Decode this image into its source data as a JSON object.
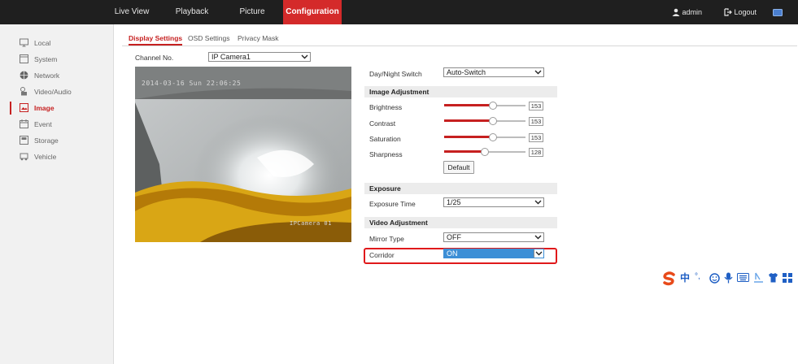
{
  "nav": {
    "tabs": [
      {
        "label": "Live View"
      },
      {
        "label": "Playback"
      },
      {
        "label": "Picture"
      },
      {
        "label": "Configuration"
      }
    ],
    "user": "admin",
    "logout": "Logout"
  },
  "sidebar": {
    "items": [
      {
        "label": "Local",
        "icon": "monitor-icon"
      },
      {
        "label": "System",
        "icon": "system-icon"
      },
      {
        "label": "Network",
        "icon": "network-icon"
      },
      {
        "label": "Video/Audio",
        "icon": "video-audio-icon"
      },
      {
        "label": "Image",
        "icon": "image-icon"
      },
      {
        "label": "Event",
        "icon": "event-icon"
      },
      {
        "label": "Storage",
        "icon": "storage-icon"
      },
      {
        "label": "Vehicle",
        "icon": "vehicle-icon"
      }
    ]
  },
  "subtabs": [
    "Display Settings",
    "OSD Settings",
    "Privacy Mask"
  ],
  "channel": {
    "label": "Channel No.",
    "value": "IP Camera1"
  },
  "video": {
    "osd_time": "2014-03-16 Sun 22:06:25",
    "osd_name": "IPCamera 01"
  },
  "settings": {
    "day_night": {
      "label": "Day/Night Switch",
      "value": "Auto-Switch"
    },
    "image_adjustment": {
      "header": "Image Adjustment",
      "brightness": {
        "label": "Brightness",
        "value": "153",
        "level": 0.6
      },
      "contrast": {
        "label": "Contrast",
        "value": "153",
        "level": 0.6
      },
      "saturation": {
        "label": "Saturation",
        "value": "153",
        "level": 0.6
      },
      "sharpness": {
        "label": "Sharpness",
        "value": "128",
        "level": 0.5
      },
      "default_button": "Default"
    },
    "exposure": {
      "header": "Exposure",
      "exposure_time": {
        "label": "Exposure Time",
        "value": "1/25"
      }
    },
    "video_adjustment": {
      "header": "Video Adjustment",
      "mirror": {
        "label": "Mirror Type",
        "value": "OFF"
      },
      "corridor": {
        "label": "Corridor",
        "value": "ON"
      }
    }
  },
  "ime": {
    "lang": "中",
    "punct": "°,"
  },
  "colors": {
    "accent": "#d42a2a",
    "highlight": "#e0191b",
    "selected": "#3d8fd6"
  }
}
